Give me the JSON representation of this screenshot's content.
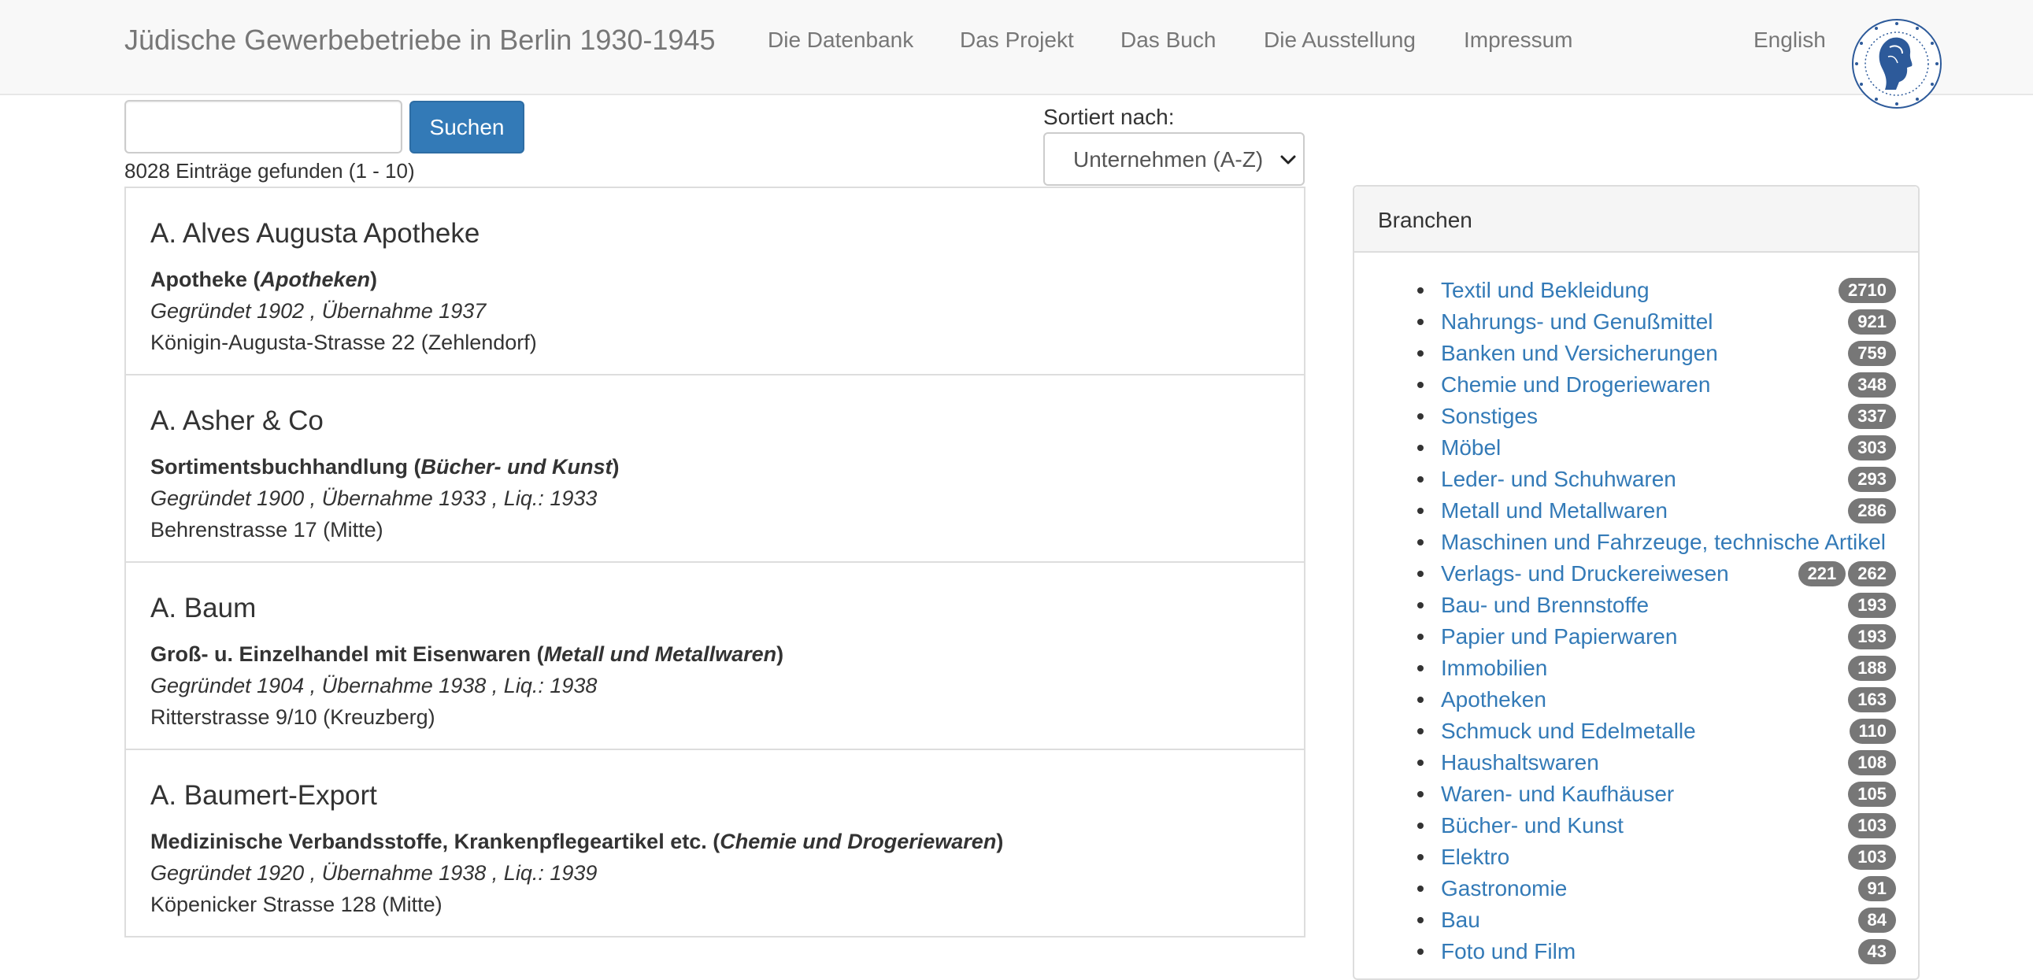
{
  "navbar": {
    "brand": "Jüdische Gewerbebetriebe in Berlin 1930-1945",
    "items": [
      "Die Datenbank",
      "Das Projekt",
      "Das Buch",
      "Die Ausstellung",
      "Impressum"
    ],
    "language": "English",
    "logo_icon": "humboldt-university-seal-icon"
  },
  "search": {
    "input_value": "",
    "button_label": "Suchen",
    "result_count": "8028 Einträge gefunden (1 - 10)"
  },
  "sort": {
    "label": "Sortiert nach:",
    "selected": "Unternehmen (A-Z)"
  },
  "entries": [
    {
      "title": "A. Alves Augusta Apotheke",
      "type": "Apotheke",
      "category": "Apotheken",
      "founded": "Gegründet 1902 , Übernahme 1937",
      "address": "Königin-Augusta-Strasse 22 (Zehlendorf)"
    },
    {
      "title": "A. Asher & Co",
      "type": "Sortimentsbuchhandlung",
      "category": "Bücher- und Kunst",
      "founded": "Gegründet 1900 , Übernahme 1933 , Liq.: 1933",
      "address": "Behrenstrasse 17 (Mitte)"
    },
    {
      "title": "A. Baum",
      "type": "Groß- u. Einzelhandel mit Eisenwaren",
      "category": "Metall und Metallwaren",
      "founded": "Gegründet 1904 , Übernahme 1938 , Liq.: 1938",
      "address": "Ritterstrasse 9/10 (Kreuzberg)"
    },
    {
      "title": "A. Baumert-Export",
      "type": "Medizinische Verbandsstoffe, Krankenpflegeartikel etc.",
      "category": "Chemie und Drogeriewaren",
      "founded": "Gegründet 1920 , Übernahme 1938 , Liq.: 1939",
      "address": "Köpenicker Strasse 128 (Mitte)"
    }
  ],
  "branchen": {
    "heading": "Branchen",
    "items": [
      {
        "label": "Textil und Bekleidung",
        "counts": [
          "2710"
        ]
      },
      {
        "label": "Nahrungs- und Genußmittel",
        "counts": [
          "921"
        ]
      },
      {
        "label": "Banken und Versicherungen",
        "counts": [
          "759"
        ]
      },
      {
        "label": "Chemie und Drogeriewaren",
        "counts": [
          "348"
        ]
      },
      {
        "label": "Sonstiges",
        "counts": [
          "337"
        ]
      },
      {
        "label": "Möbel",
        "counts": [
          "303"
        ]
      },
      {
        "label": "Leder- und Schuhwaren",
        "counts": [
          "293"
        ]
      },
      {
        "label": "Metall und Metallwaren",
        "counts": [
          "286"
        ]
      },
      {
        "label": "Maschinen und Fahrzeuge, technische Artikel",
        "counts": []
      },
      {
        "label": "Verlags- und Druckereiwesen",
        "counts": [
          "221",
          "262"
        ]
      },
      {
        "label": "Bau- und Brennstoffe",
        "counts": [
          "193"
        ]
      },
      {
        "label": "Papier und Papierwaren",
        "counts": [
          "193"
        ]
      },
      {
        "label": "Immobilien",
        "counts": [
          "188"
        ]
      },
      {
        "label": "Apotheken",
        "counts": [
          "163"
        ]
      },
      {
        "label": "Schmuck und Edelmetalle",
        "counts": [
          "110"
        ]
      },
      {
        "label": "Haushaltswaren",
        "counts": [
          "108"
        ]
      },
      {
        "label": "Waren- und Kaufhäuser",
        "counts": [
          "105"
        ]
      },
      {
        "label": "Bücher- und Kunst",
        "counts": [
          "103"
        ]
      },
      {
        "label": "Elektro",
        "counts": [
          "103"
        ]
      },
      {
        "label": "Gastronomie",
        "counts": [
          "91"
        ]
      },
      {
        "label": "Bau",
        "counts": [
          "84"
        ]
      },
      {
        "label": "Foto und Film",
        "counts": [
          "43"
        ]
      }
    ]
  },
  "colors": {
    "link": "#337ab7",
    "button": "#337ab7",
    "badge": "#777777",
    "navbar_bg": "#f8f8f8"
  }
}
